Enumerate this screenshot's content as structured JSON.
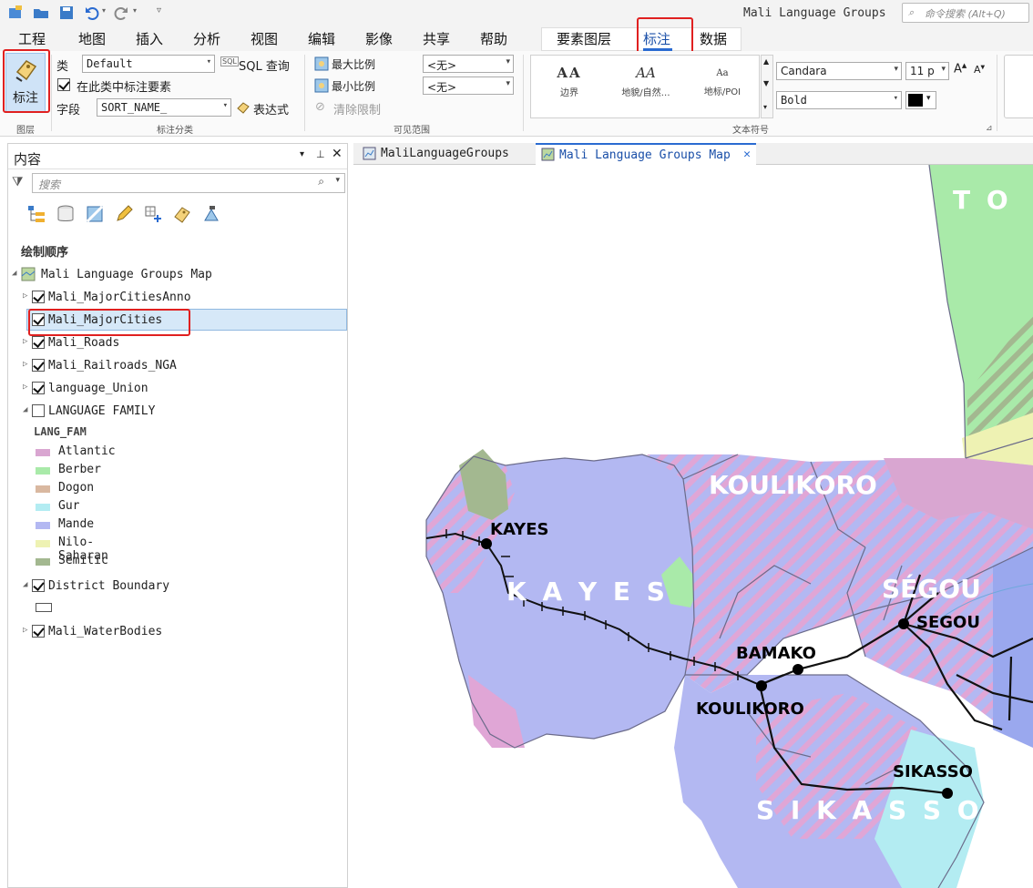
{
  "app": {
    "title": "Mali Language Groups",
    "command_search_placeholder": "命令搜索 (Alt+Q)"
  },
  "menu": {
    "tabs": [
      "工程",
      "地图",
      "插入",
      "分析",
      "视图",
      "编辑",
      "影像",
      "共享",
      "帮助"
    ],
    "contextual_tabs": [
      "要素图层",
      "标注",
      "数据"
    ],
    "active_tab": "标注"
  },
  "ribbon": {
    "labeling_button": "标注",
    "group_layer": "图层",
    "class_label": "类",
    "class_value": "Default",
    "sql_label": "SQL 查询",
    "label_features_in_class": "在此类中标注要素",
    "field_label": "字段",
    "field_value": "SORT_NAME_",
    "expression_label": "表达式",
    "group_label_class": "标注分类",
    "max_scale": "最大比例",
    "min_scale": "最小比例",
    "max_scale_value": "<无>",
    "min_scale_value": "<无>",
    "clear_limits": "清除限制",
    "group_visible_range": "可见范围",
    "symbols": [
      {
        "glyph": "AA",
        "label": "边界"
      },
      {
        "glyph": "AA",
        "label": "地貌/自然…"
      },
      {
        "glyph": "Aa",
        "label": "地标/POI"
      }
    ],
    "group_text_symbol": "文本符号",
    "font_name": "Candara",
    "font_size": "11 p",
    "font_style": "Bold",
    "font_color": "#000000"
  },
  "contents": {
    "title": "内容",
    "search_placeholder": "搜索",
    "drawing_order": "绘制顺序",
    "map_name": "Mali Language Groups Map",
    "layers": [
      {
        "name": "Mali_MajorCitiesAnno",
        "checked": true
      },
      {
        "name": "Mali_MajorCities",
        "checked": true
      },
      {
        "name": "Mali_Roads",
        "checked": true
      },
      {
        "name": "Mali_Railroads_NGA",
        "checked": true
      },
      {
        "name": "language_Union",
        "checked": true
      },
      {
        "name": "LANGUAGE FAMILY",
        "checked": false
      }
    ],
    "legend_field": "LANG_FAM",
    "legend": [
      {
        "label": "Atlantic",
        "color": "#d9a6d1"
      },
      {
        "label": "Berber",
        "color": "#a9eaa9"
      },
      {
        "label": "Dogon",
        "color": "#d9b8a0"
      },
      {
        "label": "Gur",
        "color": "#b3ecf2"
      },
      {
        "label": "Mande",
        "color": "#b3b8f2"
      },
      {
        "label": "Nilo-Saharan",
        "color": "#eef2b3"
      },
      {
        "label": "Semitic",
        "color": "#a3b890"
      }
    ],
    "more_layers": [
      {
        "name": "District Boundary",
        "checked": true
      },
      {
        "name": "Mali_WaterBodies",
        "checked": true
      }
    ]
  },
  "views": {
    "tabs": [
      "MaliLanguageGroups",
      "Mali Language Groups Map"
    ],
    "active": "Mali Language Groups Map"
  },
  "map": {
    "region_labels": [
      "KOULIKORO",
      "K A Y E S",
      "SÉGOU",
      "S I K A S S O",
      "T O"
    ],
    "city_labels": [
      "KAYES",
      "BAMAKO",
      "KOULIKORO",
      "SEGOU",
      "SIKASSO"
    ]
  }
}
